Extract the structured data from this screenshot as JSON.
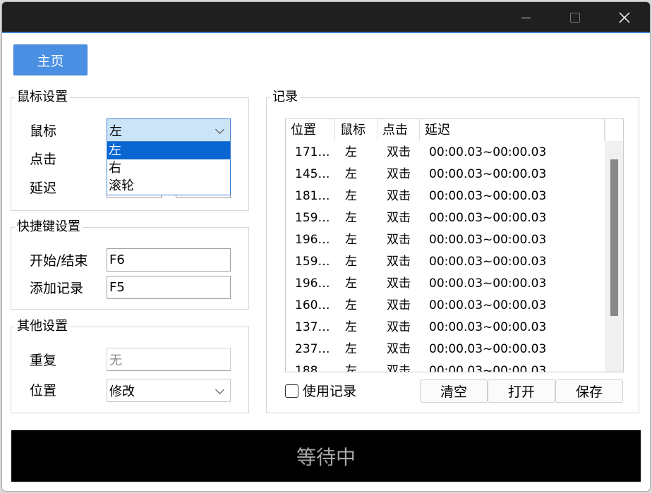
{
  "titlebar": {
    "minimize_icon": "minimize-icon",
    "maximize_icon": "maximize-icon",
    "close_icon": "close-icon",
    "close_glyph": "✕"
  },
  "home_button": "主页",
  "mouse_settings": {
    "title": "鼠标设置",
    "mouse_label": "鼠标",
    "mouse_value": "左",
    "click_label": "点击",
    "delay_label": "延迟",
    "dropdown_options": [
      "左",
      "右",
      "滚轮"
    ],
    "selected_option": "左"
  },
  "hotkey_settings": {
    "title": "快捷键设置",
    "start_stop_label": "开始/结束",
    "start_stop_value": "F6",
    "add_record_label": "添加记录",
    "add_record_value": "F5"
  },
  "other_settings": {
    "title": "其他设置",
    "repeat_label": "重复",
    "repeat_value": "无",
    "position_label": "位置",
    "position_value": "修改"
  },
  "records": {
    "title": "记录",
    "columns": [
      "位置",
      "鼠标",
      "点击",
      "延迟"
    ],
    "rows": [
      [
        "1717...",
        "左",
        "双击",
        "00:00.03~00:00.03"
      ],
      [
        "1451...",
        "左",
        "双击",
        "00:00.03~00:00.03"
      ],
      [
        "1811...",
        "左",
        "双击",
        "00:00.03~00:00.03"
      ],
      [
        "1595...",
        "左",
        "双击",
        "00:00.03~00:00.03"
      ],
      [
        "1963...",
        "左",
        "双击",
        "00:00.03~00:00.03"
      ],
      [
        "1593...",
        "左",
        "双击",
        "00:00.03~00:00.03"
      ],
      [
        "1963...",
        "左",
        "双击",
        "00:00.03~00:00.03"
      ],
      [
        "1608...",
        "左",
        "双击",
        "00:00.03~00:00.03"
      ],
      [
        "1375...",
        "左",
        "双击",
        "00:00.03~00:00.03"
      ],
      [
        "2374...",
        "左",
        "双击",
        "00:00.03~00:00.03"
      ],
      [
        "1880...",
        "左",
        "双击",
        "00:00.03~00:00.03"
      ]
    ],
    "use_records_label": "使用记录",
    "use_records_checked": false,
    "clear_button": "清空",
    "open_button": "打开",
    "save_button": "保存"
  },
  "status_text": "等待中",
  "colors": {
    "accent": "#4a8fe2",
    "titlebar": "#1f1f1f",
    "status_bg": "#000000",
    "selection": "#0a66d1"
  }
}
